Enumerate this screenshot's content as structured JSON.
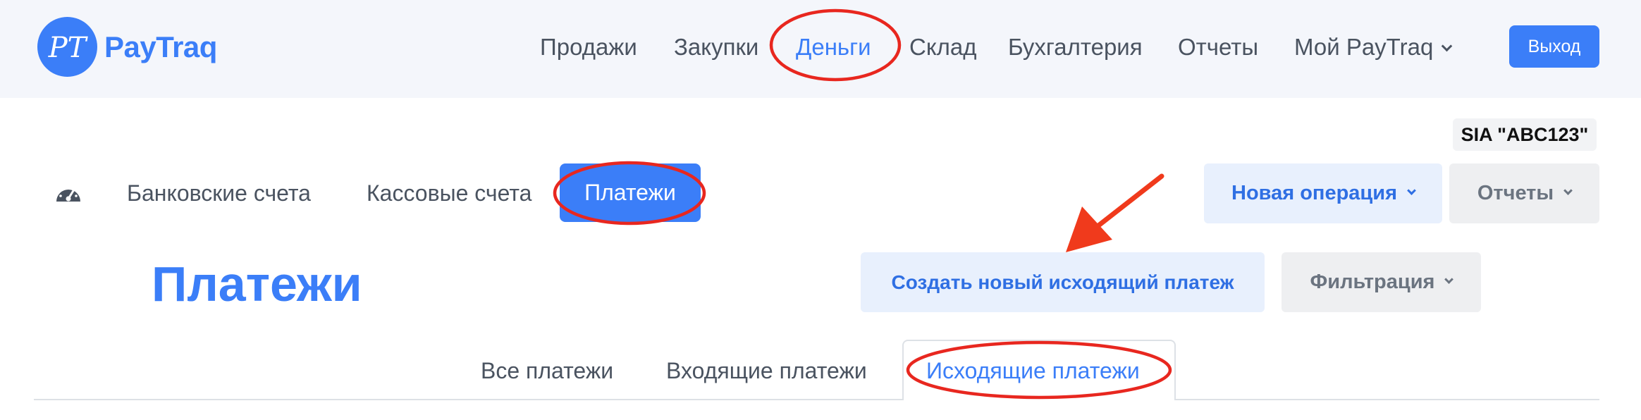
{
  "brand": {
    "logo_monogram": "PT",
    "name": "PayTraq",
    "color": "#3b7ef8"
  },
  "topnav": {
    "items": [
      {
        "label": "Продажи"
      },
      {
        "label": "Закупки"
      },
      {
        "label": "Деньги",
        "active": true
      },
      {
        "label": "Склад"
      },
      {
        "label": "Бухгалтерия"
      },
      {
        "label": "Отчеты"
      },
      {
        "label": "Мой PayTraq",
        "has_dropdown": true,
        "icon": "chevron-down-icon"
      }
    ],
    "logout_label": "Выход"
  },
  "company": {
    "name": "SIA \"ABC123\""
  },
  "subnav": {
    "dashboard_icon": "speedometer-icon",
    "items": [
      {
        "label": "Банковские счета"
      },
      {
        "label": "Кассовые счета"
      },
      {
        "label": "Платежи",
        "active": true
      }
    ],
    "new_operation_label": "Новая операция",
    "reports_label": "Отчеты"
  },
  "page": {
    "title": "Платежи",
    "create_button_label": "Создать новый исходящий платеж",
    "filter_label": "Фильтрация"
  },
  "tabs": {
    "items": [
      {
        "label": "Все платежи"
      },
      {
        "label": "Входящие платежи"
      },
      {
        "label": "Исходящие платежи",
        "active": true
      }
    ]
  },
  "annotations": {
    "highlight_color": "#e8271f",
    "arrow_color": "#f03a1c"
  }
}
